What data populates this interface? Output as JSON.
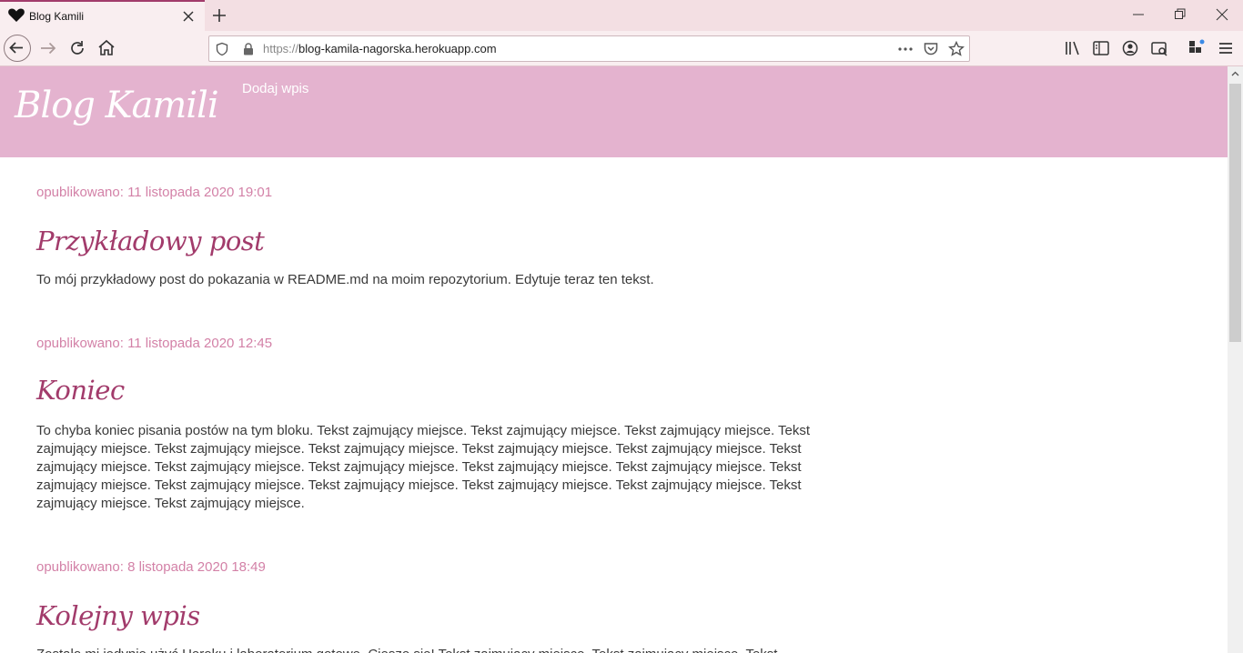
{
  "browser": {
    "tab_title": "Blog Kamili",
    "url_scheme": "https://",
    "url_host": "blog-kamila-nagorska.herokuapp.com"
  },
  "site": {
    "logo": "Blog Kamili",
    "nav_add_post": "Dodaj wpis"
  },
  "posts": [
    {
      "date": "opublikowano: 11 listopada 2020 19:01",
      "title": "Przykładowy post",
      "body": "To mój przykładowy post do pokazania w README.md na moim repozytorium. Edytuje teraz ten tekst."
    },
    {
      "date": "opublikowano: 11 listopada 2020 12:45",
      "title": "Koniec",
      "body": "To chyba koniec pisania postów na tym bloku. Tekst zajmujący miejsce. Tekst zajmujący miejsce. Tekst zajmujący miejsce. Tekst zajmujący miejsce. Tekst zajmujący miejsce. Tekst zajmujący miejsce. Tekst zajmujący miejsce. Tekst zajmujący miejsce. Tekst zajmujący miejsce. Tekst zajmujący miejsce. Tekst zajmujący miejsce. Tekst zajmujący miejsce. Tekst zajmujący miejsce. Tekst zajmujący miejsce. Tekst zajmujący miejsce. Tekst zajmujący miejsce. Tekst zajmujący miejsce. Tekst zajmujący miejsce. Tekst zajmujący miejsce. Tekst zajmujący miejsce."
    },
    {
      "date": "opublikowano: 8 listopada 2020 18:49",
      "title": "Kolejny wpis",
      "body": "Zostało mi jedynie użyć Heroku i laboratorium gotowe. Cieszę się! Tekst zajmujący miejsce. Tekst zajmujący miejsce. Tekst"
    }
  ],
  "colors": {
    "header_bg": "#e4b3cf",
    "accent": "#a23b6b",
    "date": "#d381a7"
  }
}
